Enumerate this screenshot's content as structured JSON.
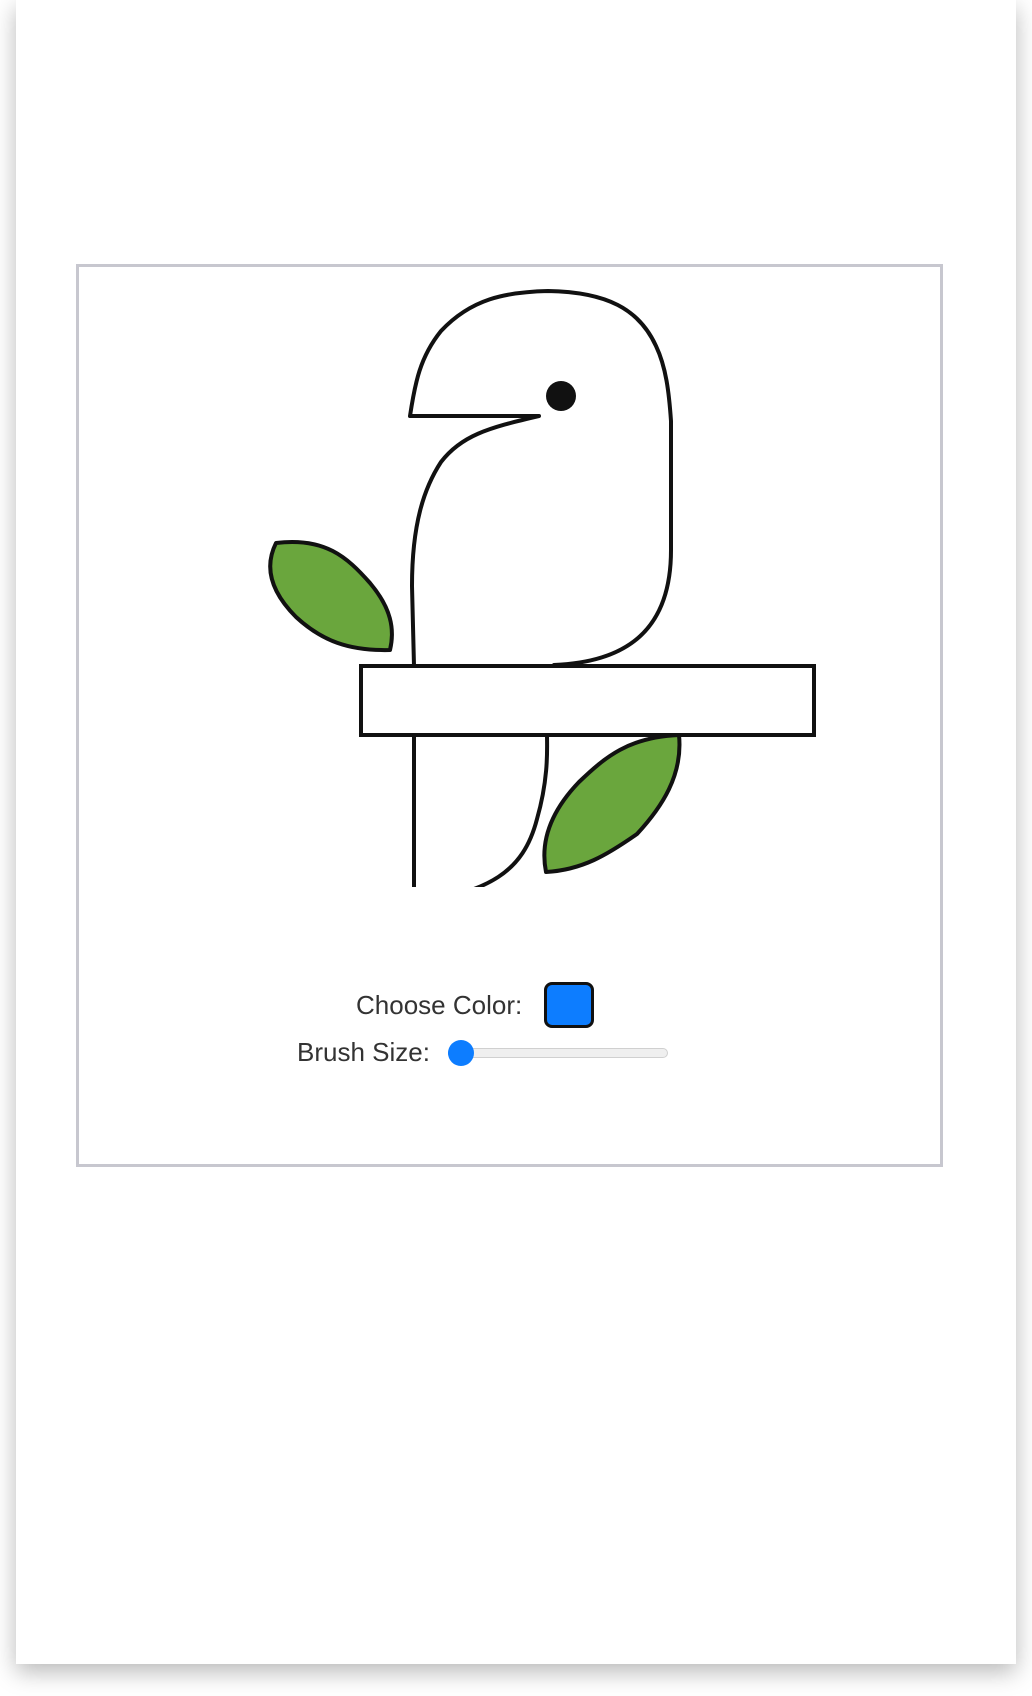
{
  "page_header": {
    "text": ""
  },
  "drawing": {
    "name": "parrot-on-perch",
    "colors": {
      "outline": "#111111",
      "bird_fill": "#ffffff",
      "leaf_fill": "#6aa63d",
      "eye": "#111111"
    }
  },
  "controls": {
    "color_picker": {
      "label": "Choose Color:",
      "value": "#0d7dff"
    },
    "brush_size": {
      "label": "Brush Size:",
      "value_fraction": 0.02
    }
  },
  "theme": {
    "accent": "#0d7dff",
    "panel_border": "#c7c7cf"
  }
}
